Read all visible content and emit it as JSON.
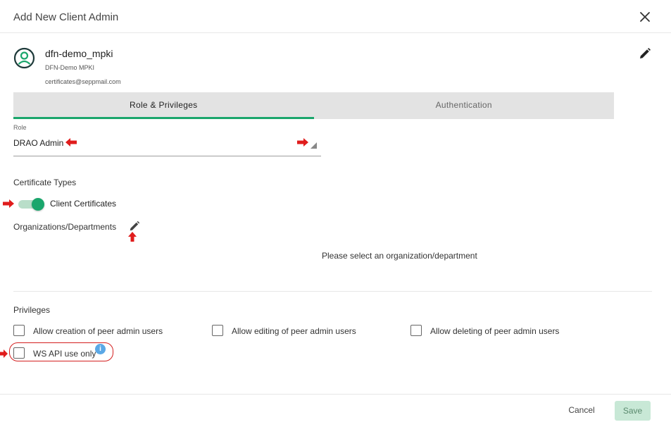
{
  "dialog": {
    "title": "Add New Client Admin",
    "close_icon": "close-icon"
  },
  "user": {
    "name": "dfn-demo_mpki",
    "organization": "DFN-Demo MPKI",
    "email": "certificates@seppmail.com",
    "avatar_icon": "user-circle-icon",
    "edit_icon": "pencil-icon"
  },
  "tabs": [
    {
      "label": "Role & Privileges",
      "active": true
    },
    {
      "label": "Authentication",
      "active": false
    }
  ],
  "role": {
    "label": "Role",
    "value": "DRAO Admin"
  },
  "certificate_types": {
    "label": "Certificate Types",
    "toggle_label": "Client Certificates",
    "enabled": true
  },
  "organizations": {
    "label": "Organizations/Departments",
    "empty_message": "Please select an organization/department",
    "edit_icon": "pencil-icon"
  },
  "privileges": {
    "label": "Privileges",
    "items": [
      {
        "label": "Allow creation of peer admin users",
        "checked": false
      },
      {
        "label": "Allow editing of peer admin users",
        "checked": false
      },
      {
        "label": "Allow deleting of peer admin users",
        "checked": false
      },
      {
        "label": "WS API use only",
        "checked": false
      }
    ],
    "info_icon": "info-icon"
  },
  "footer": {
    "cancel_label": "Cancel",
    "save_label": "Save"
  },
  "colors": {
    "accent": "#1aa66c",
    "annotation_red": "#d42020",
    "info_blue": "#5aa8e6"
  }
}
